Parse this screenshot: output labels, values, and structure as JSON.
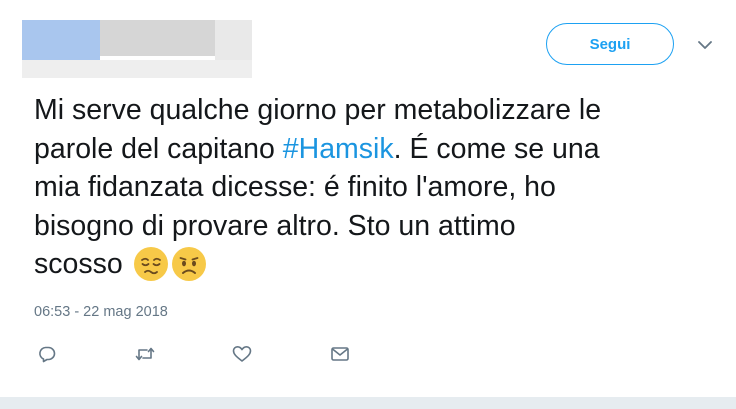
{
  "header": {
    "follow_label": "Segui",
    "caret_icon": "chevron-down-icon"
  },
  "tweet": {
    "lines": [
      "Mi serve qualche giorno per metabolizzare le",
      "parole del capitano ",
      "#Hamsik",
      ". É come se una",
      "mia fidanzata dicesse: é finito l'amore, ho",
      "bisogno di provare altro. Sto un attimo",
      "scosso "
    ],
    "emojis": [
      "relieved-pensive-face-emoji",
      "frowning-face-emoji"
    ],
    "timestamp": "06:53 - 22 mag 2018"
  },
  "actions": [
    "reply-icon",
    "retweet-icon",
    "like-icon",
    "direct-message-icon"
  ],
  "colors": {
    "accent": "#1da1f2",
    "hashtag": "#1b95e0",
    "text": "#14171a",
    "muted": "#657786",
    "emoji_yellow": "#f7c948"
  }
}
